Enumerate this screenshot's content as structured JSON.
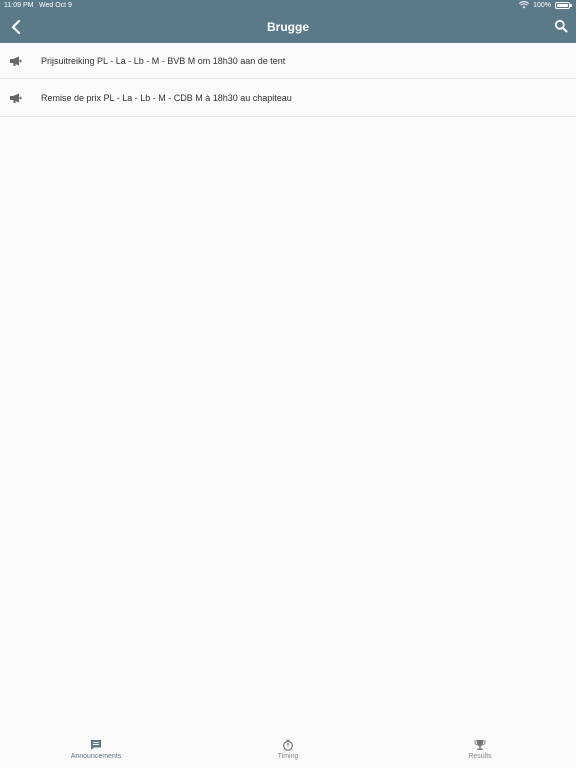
{
  "status_bar": {
    "time": "11:09 PM",
    "date": "Wed Oct 9",
    "battery": "100%"
  },
  "header": {
    "title": "Brugge",
    "back_icon": "chevron-left-icon",
    "search_icon": "search-icon"
  },
  "announcements": [
    {
      "text": "Prijsuitreiking PL - La - Lb - M - BVB M om 18h30 aan de tent",
      "icon": "megaphone-icon"
    },
    {
      "text": "Remise de prix PL - La - Lb - M - CDB M à 18h30 au chapiteau",
      "icon": "megaphone-icon"
    }
  ],
  "tabs": [
    {
      "label": "Announcements",
      "icon": "announcement-icon",
      "active": true
    },
    {
      "label": "Timing",
      "icon": "stopwatch-icon",
      "active": false
    },
    {
      "label": "Results",
      "icon": "trophy-icon",
      "active": false
    }
  ],
  "colors": {
    "header": "#5b7a89",
    "background": "#fafafa",
    "text": "#333333",
    "inactive_tab": "#8a8a8a"
  }
}
